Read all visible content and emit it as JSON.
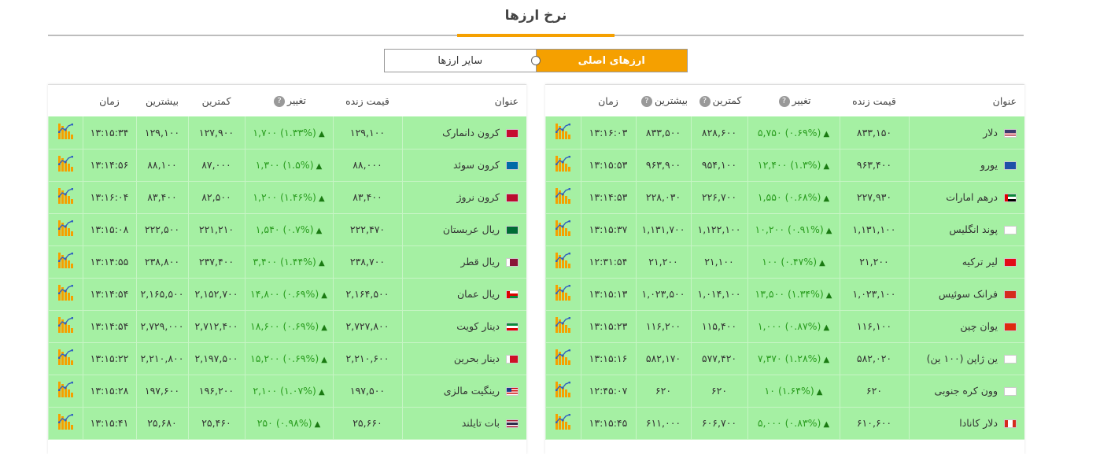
{
  "page": {
    "title": "نرخ ارزها"
  },
  "switch": {
    "main_label": "ارزهای اصلی",
    "other_label": "سایر ارزها"
  },
  "columns": {
    "name": "عنوان",
    "live": "قیمت زنده",
    "change": "تغییر",
    "low": "کمترین",
    "high": "بیشترین",
    "time": "زمان",
    "help": "?"
  },
  "colors": {
    "row_bg": "#a5f0a3",
    "accent": "#f5a000",
    "change_text": "#2a9d1f"
  },
  "right_table": [
    {
      "name": "دلار",
      "flag": "us-flag",
      "live": "۸۳۳,۱۵۰",
      "change": "(۰.۶۹%) ۵,۷۵۰",
      "low": "۸۲۸,۶۰۰",
      "high": "۸۳۳,۵۰۰",
      "time": "۱۳:۱۶:۰۳"
    },
    {
      "name": "یورو",
      "flag": "eu-flag",
      "live": "۹۶۳,۴۰۰",
      "change": "(۱.۳%) ۱۲,۴۰۰",
      "low": "۹۵۴,۱۰۰",
      "high": "۹۶۳,۹۰۰",
      "time": "۱۳:۱۵:۵۳"
    },
    {
      "name": "درهم امارات",
      "flag": "ae-flag",
      "live": "۲۲۷,۹۳۰",
      "change": "(۰.۶۸%) ۱,۵۵۰",
      "low": "۲۲۶,۷۰۰",
      "high": "۲۲۸,۰۳۰",
      "time": "۱۳:۱۴:۵۳"
    },
    {
      "name": "پوند انگلیس",
      "flag": "gb-flag",
      "live": "۱,۱۳۱,۱۰۰",
      "change": "(۰.۹۱%) ۱۰,۲۰۰",
      "low": "۱,۱۲۲,۱۰۰",
      "high": "۱,۱۳۱,۷۰۰",
      "time": "۱۳:۱۵:۳۷"
    },
    {
      "name": "لیر ترکیه",
      "flag": "tr-flag",
      "live": "۲۱,۲۰۰",
      "change": "(۰.۴۷%) ۱۰۰",
      "low": "۲۱,۱۰۰",
      "high": "۲۱,۲۰۰",
      "time": "۱۲:۳۱:۵۴"
    },
    {
      "name": "فرانک سوئیس",
      "flag": "ch-flag",
      "live": "۱,۰۲۳,۱۰۰",
      "change": "(۱.۳۴%) ۱۳,۵۰۰",
      "low": "۱,۰۱۴,۱۰۰",
      "high": "۱,۰۲۳,۵۰۰",
      "time": "۱۳:۱۵:۱۳"
    },
    {
      "name": "یوان چین",
      "flag": "cn-flag",
      "live": "۱۱۶,۱۰۰",
      "change": "(۰.۸۷%) ۱,۰۰۰",
      "low": "۱۱۵,۴۰۰",
      "high": "۱۱۶,۲۰۰",
      "time": "۱۳:۱۵:۲۳"
    },
    {
      "name": "ین ژاپن (۱۰۰ ین)",
      "flag": "jp-flag",
      "live": "۵۸۲,۰۲۰",
      "change": "(۱.۲۸%) ۷,۳۷۰",
      "low": "۵۷۷,۴۲۰",
      "high": "۵۸۲,۱۷۰",
      "time": "۱۳:۱۵:۱۶"
    },
    {
      "name": "وون کره جنوبی",
      "flag": "kr-flag",
      "live": "۶۲۰",
      "change": "(۱.۶۴%) ۱۰",
      "low": "۶۲۰",
      "high": "۶۲۰",
      "time": "۱۲:۴۵:۰۷"
    },
    {
      "name": "دلار کانادا",
      "flag": "ca-flag",
      "live": "۶۱۰,۶۰۰",
      "change": "(۰.۸۳%) ۵,۰۰۰",
      "low": "۶۰۶,۷۰۰",
      "high": "۶۱۱,۰۰۰",
      "time": "۱۳:۱۵:۴۵"
    }
  ],
  "left_table": [
    {
      "name": "کرون دانمارک",
      "flag": "dk-flag",
      "live": "۱۲۹,۱۰۰",
      "change": "(۱.۳۳%) ۱,۷۰۰",
      "low": "۱۲۷,۹۰۰",
      "high": "۱۲۹,۱۰۰",
      "time": "۱۳:۱۵:۳۴"
    },
    {
      "name": "کرون سوئد",
      "flag": "se-flag",
      "live": "۸۸,۰۰۰",
      "change": "(۱.۵%) ۱,۳۰۰",
      "low": "۸۷,۰۰۰",
      "high": "۸۸,۱۰۰",
      "time": "۱۳:۱۴:۵۶"
    },
    {
      "name": "کرون نروژ",
      "flag": "no-flag",
      "live": "۸۳,۴۰۰",
      "change": "(۱.۴۶%) ۱,۲۰۰",
      "low": "۸۲,۵۰۰",
      "high": "۸۳,۴۰۰",
      "time": "۱۳:۱۶:۰۴"
    },
    {
      "name": "ریال عربستان",
      "flag": "sa-flag",
      "live": "۲۲۲,۴۷۰",
      "change": "(۰.۷%) ۱,۵۴۰",
      "low": "۲۲۱,۲۱۰",
      "high": "۲۲۲,۵۰۰",
      "time": "۱۳:۱۵:۰۸"
    },
    {
      "name": "ریال قطر",
      "flag": "qa-flag",
      "live": "۲۳۸,۷۰۰",
      "change": "(۱.۴۴%) ۳,۴۰۰",
      "low": "۲۳۷,۴۰۰",
      "high": "۲۳۸,۸۰۰",
      "time": "۱۳:۱۴:۵۵"
    },
    {
      "name": "ریال عمان",
      "flag": "om-flag",
      "live": "۲,۱۶۴,۵۰۰",
      "change": "(۰.۶۹%) ۱۴,۸۰۰",
      "low": "۲,۱۵۲,۷۰۰",
      "high": "۲,۱۶۵,۵۰۰",
      "time": "۱۳:۱۴:۵۴"
    },
    {
      "name": "دینار کویت",
      "flag": "kw-flag",
      "live": "۲,۷۲۷,۸۰۰",
      "change": "(۰.۶۹%) ۱۸,۶۰۰",
      "low": "۲,۷۱۲,۴۰۰",
      "high": "۲,۷۲۹,۰۰۰",
      "time": "۱۳:۱۴:۵۴"
    },
    {
      "name": "دینار بحرین",
      "flag": "bh-flag",
      "live": "۲,۲۱۰,۶۰۰",
      "change": "(۰.۶۹%) ۱۵,۲۰۰",
      "low": "۲,۱۹۷,۵۰۰",
      "high": "۲,۲۱۰,۸۰۰",
      "time": "۱۳:۱۵:۲۲"
    },
    {
      "name": "رینگیت مالزی",
      "flag": "my-flag",
      "live": "۱۹۷,۵۰۰",
      "change": "(۱.۰۷%) ۲,۱۰۰",
      "low": "۱۹۶,۲۰۰",
      "high": "۱۹۷,۶۰۰",
      "time": "۱۳:۱۵:۲۸"
    },
    {
      "name": "بات تایلند",
      "flag": "th-flag",
      "live": "۲۵,۶۶۰",
      "change": "(۰.۹۸%) ۲۵۰",
      "low": "۲۵,۴۶۰",
      "high": "۲۵,۶۸۰",
      "time": "۱۳:۱۵:۴۱"
    }
  ]
}
